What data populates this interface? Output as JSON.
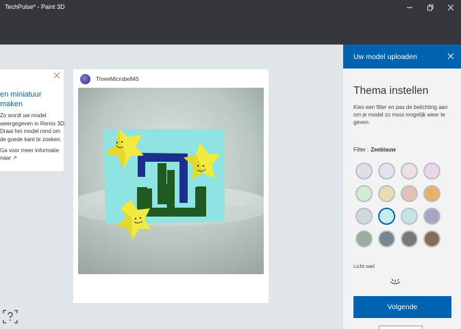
{
  "window": {
    "title": "TechPulse* - Paint 3D"
  },
  "tip": {
    "title": "en miniatuur\nmaken",
    "body": "Zo wordt uw model\nweergegeven in Remix 3D.\nDraai het model rond om\nde goede kant te zoeken.",
    "link": "Ga voor meer informatie\nnaar ↗"
  },
  "post": {
    "username": "ThreeMicrobe845"
  },
  "panel": {
    "header_title": "Uw model uploaden",
    "title": "Thema instellen",
    "description": "Kies een filter en pas de belichting aan om je model zo mooi mogelijk weer te geven.",
    "filter_label": "Filter :",
    "filter_value": "Zeeblauw",
    "swatches": [
      "#dde1e5",
      "#e3e3f0",
      "#efdfe4",
      "#e9d9e8",
      "#d3ebd5",
      "#ecdbb3",
      "#e5c0b7",
      "#e9b06b",
      "#cfd8da",
      "#c8ecec",
      "#c3e3e6",
      "#a8a4c4",
      "#9cad9c",
      "#788692",
      "#787878",
      "#876a57"
    ],
    "selected_swatch": "Zeeblauw",
    "light_label": "Licht wiel",
    "next_label": "Volgende"
  }
}
